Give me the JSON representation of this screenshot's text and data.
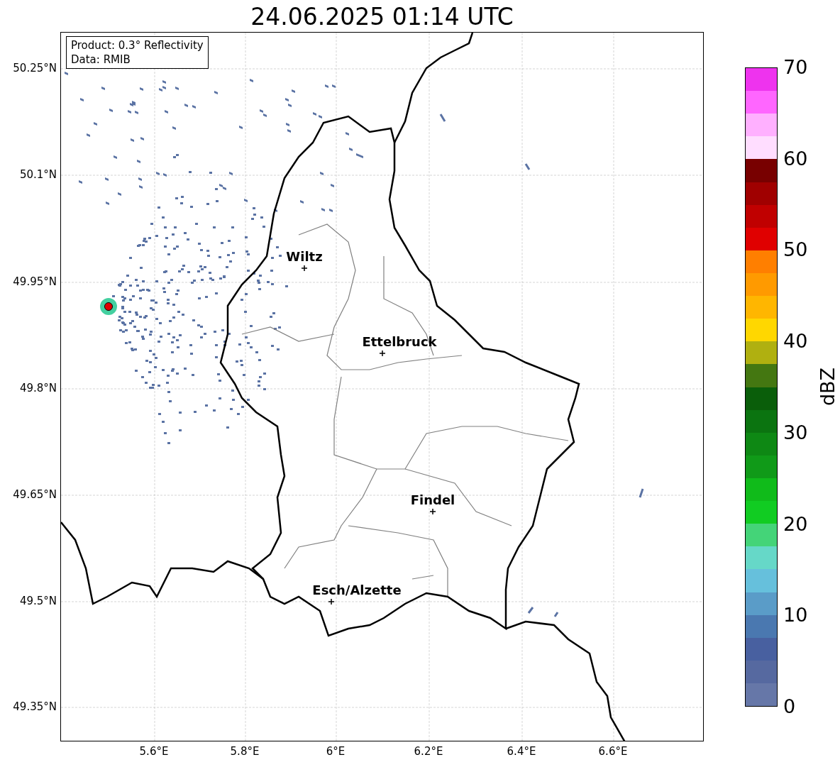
{
  "title": "24.06.2025 01:14 UTC",
  "info_box": [
    "Product: 0.3° Reflectivity",
    "Data: RMIB"
  ],
  "map": {
    "y_ticks": [
      "50.25°N",
      "50.1°N",
      "49.95°N",
      "49.8°N",
      "49.65°N",
      "49.5°N",
      "49.35°N"
    ],
    "x_ticks": [
      "5.6°E",
      "5.8°E",
      "6°E",
      "6.2°E",
      "6.4°E",
      "6.6°E"
    ],
    "cities": [
      {
        "name": "Wiltz"
      },
      {
        "name": "Ettelbruck"
      },
      {
        "name": "Findel"
      },
      {
        "name": "Esch/Alzette"
      }
    ]
  },
  "colorbar": {
    "label": "dBZ",
    "ticks": [
      "70",
      "60",
      "50",
      "40",
      "30",
      "20",
      "10",
      "0"
    ],
    "bands": [
      {
        "color": "#ee33ee"
      },
      {
        "color": "#ff66ff"
      },
      {
        "color": "#ffb0ff"
      },
      {
        "color": "#ffddff"
      },
      {
        "color": "#780000"
      },
      {
        "color": "#a00000"
      },
      {
        "color": "#c00000"
      },
      {
        "color": "#e00000"
      },
      {
        "color": "#ff7f00"
      },
      {
        "color": "#ff9a00"
      },
      {
        "color": "#ffb600"
      },
      {
        "color": "#ffd700"
      },
      {
        "color": "#b0b010"
      },
      {
        "color": "#447711"
      },
      {
        "color": "#0a5e0a"
      },
      {
        "color": "#0b7410"
      },
      {
        "color": "#0e8814"
      },
      {
        "color": "#109a18"
      },
      {
        "color": "#10bb1a"
      },
      {
        "color": "#11cc22"
      },
      {
        "color": "#44d478"
      },
      {
        "color": "#66d8c8"
      },
      {
        "color": "#66c0dc"
      },
      {
        "color": "#5a9cc8"
      },
      {
        "color": "#4a78b0"
      },
      {
        "color": "#4860a0"
      },
      {
        "color": "#5669a0"
      },
      {
        "color": "#6677a8"
      }
    ]
  }
}
